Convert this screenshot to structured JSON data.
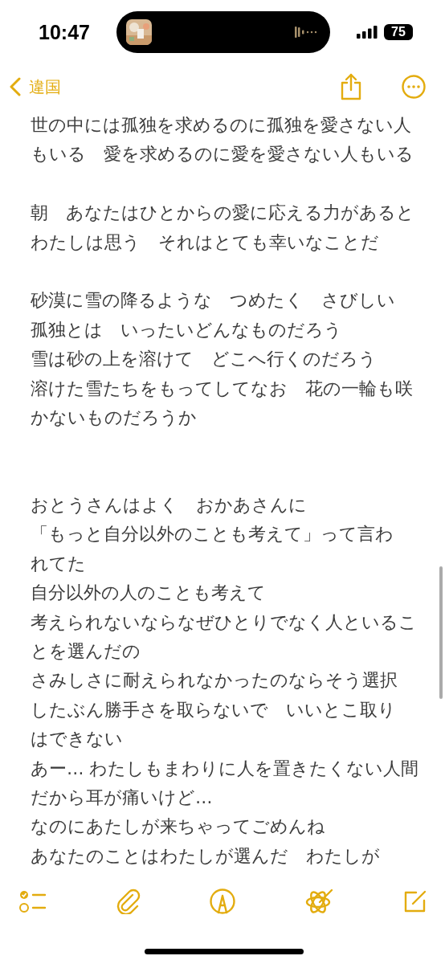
{
  "status_bar": {
    "time": "10:47",
    "battery": "75"
  },
  "nav": {
    "back_label": "違国"
  },
  "body": [
    {
      "kind": "line",
      "text": "世の中には孤独を求めるのに孤独を愛さない人"
    },
    {
      "kind": "line",
      "text": "もいる　愛を求めるのに愛を愛さない人もいる"
    },
    {
      "kind": "blank"
    },
    {
      "kind": "line",
      "text": "朝　あなたはひとからの愛に応える力があると"
    },
    {
      "kind": "line",
      "text": "わたしは思う　それはとても幸いなことだ"
    },
    {
      "kind": "blank"
    },
    {
      "kind": "line",
      "text": "砂漠に雪の降るような　つめたく　さびしい"
    },
    {
      "kind": "line",
      "text": "孤独とは　いったいどんなものだろう"
    },
    {
      "kind": "line",
      "text": "雪は砂の上を溶けて　どこへ行くのだろう"
    },
    {
      "kind": "line",
      "text": "溶けた雪たちをもってしてなお　花の一輪も咲"
    },
    {
      "kind": "line",
      "text": "かないものだろうか"
    },
    {
      "kind": "blank"
    },
    {
      "kind": "blank"
    },
    {
      "kind": "line",
      "text": "おとうさんはよく　おかあさんに"
    },
    {
      "kind": "line",
      "text": "「もっと自分以外のことも考えて」って言わ"
    },
    {
      "kind": "line",
      "text": "れてた"
    },
    {
      "kind": "line",
      "text": "自分以外の人のことも考えて"
    },
    {
      "kind": "line",
      "text": "考えられないならなぜひとりでなく人といるこ"
    },
    {
      "kind": "line",
      "text": "とを選んだの"
    },
    {
      "kind": "line",
      "text": "さみしさに耐えられなかったのならそう選択"
    },
    {
      "kind": "line",
      "text": "したぶん勝手さを取らないで　いいとこ取り"
    },
    {
      "kind": "line",
      "text": "はできない"
    },
    {
      "kind": "line",
      "text": "あー… わたしもまわりに人を置きたくない人間"
    },
    {
      "kind": "line",
      "text": "だから耳が痛いけど…"
    },
    {
      "kind": "line",
      "text": "なのにあたしが来ちゃってごめんね"
    },
    {
      "kind": "line",
      "text": "あなたのことはわたしが選んだ　わたしが"
    }
  ]
}
